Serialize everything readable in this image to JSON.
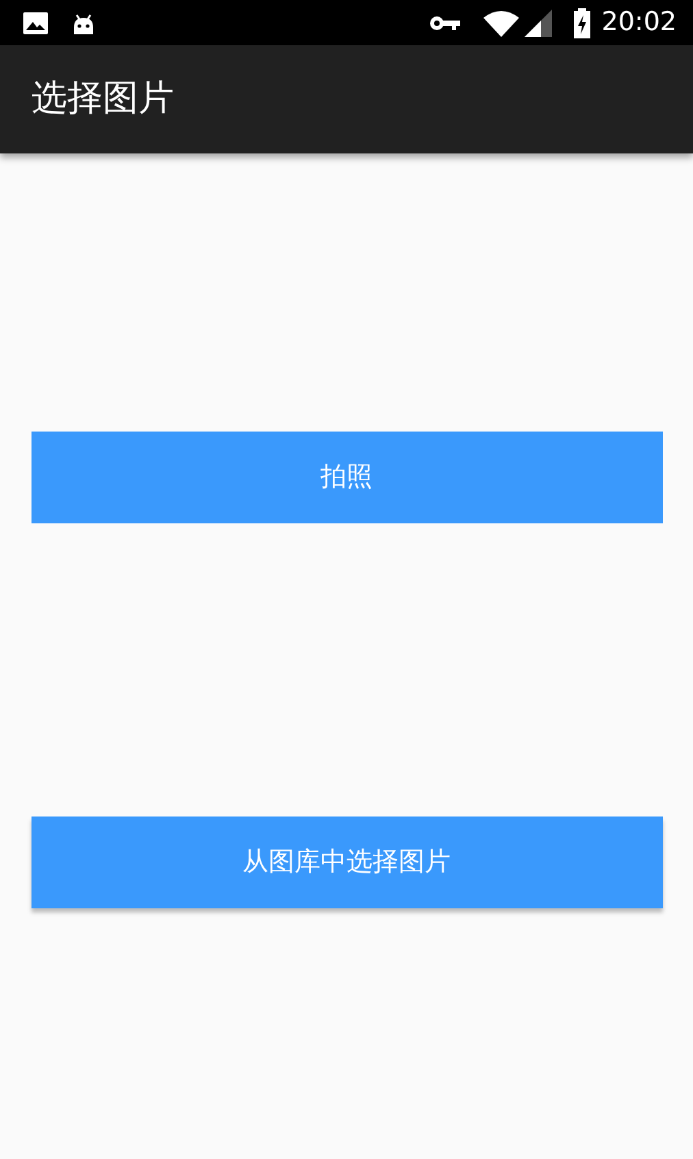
{
  "status_bar": {
    "time": "20:02"
  },
  "app_bar": {
    "title": "选择图片"
  },
  "buttons": [
    {
      "label": "拍照",
      "raised": false
    },
    {
      "label": "从图库中选择图片",
      "raised": true
    }
  ]
}
